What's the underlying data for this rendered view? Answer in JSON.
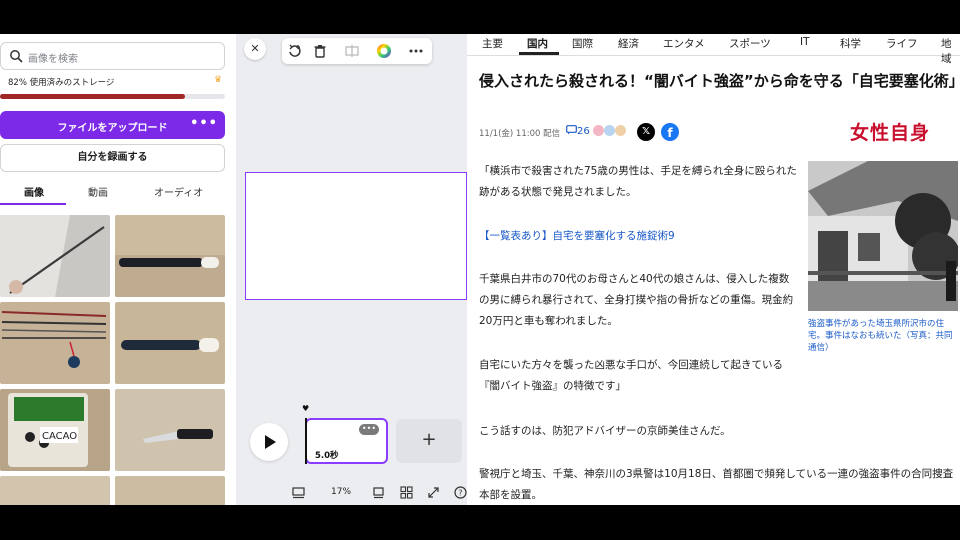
{
  "media_panel": {
    "search_placeholder": "画像を検索",
    "storage_text": "82% 使用済みのストレージ",
    "storage_used_fraction": 0.82,
    "upload_label": "ファイルをアップロード",
    "more_label": "•••",
    "record_label": "自分を録画する",
    "tabs": [
      "画像",
      "動画",
      "オーディオ"
    ],
    "active_tab": "画像"
  },
  "editor": {
    "close_label": "✕",
    "clip_duration": "5.0秒",
    "clip_menu": "•••",
    "add_clip": "+",
    "zoom": "17%"
  },
  "article": {
    "nav": [
      "主要",
      "国内",
      "国際",
      "経済",
      "エンタメ",
      "スポーツ",
      "IT",
      "科学",
      "ライフ",
      "地域"
    ],
    "active_nav": "国内",
    "headline": "侵入されたら殺される！“闇バイト強盗”から命を守る「自宅要塞化術」",
    "meta": "11/1(金) 11:00 配信",
    "comment_count": "26",
    "x_label": "𝕏",
    "fb_label": "f",
    "publisher": "女性自身",
    "paragraphs": [
      "「横浜市で殺害された75歳の男性は、手足を縛られ全身に殴られた跡がある状態で発見されました。",
      "【一覧表あり】自宅を要塞化する施錠術9",
      "千葉県白井市の70代のお母さんと40代の娘さんは、侵入した複数の男に縛られ暴行されて、全身打撲や指の骨折などの重傷。現金約20万円と車も奪われました。",
      "自宅にいた方々を襲った凶悪な手口が、今回連続して起きている『闇バイト強盗』の特徴です」",
      "こう話すのは、防犯アドバイザーの京師美佳さんだ。",
      "警視庁と埼玉、千葉、神奈川の3県警は10月18日、首都圏で頻発している一連の強盗事件の合同捜査本部を設置。"
    ],
    "photo_caption": "強盗事件があった埼玉県所沢市の住宅。事件はなおも続いた（写真：共同通信）"
  },
  "colors": {
    "accent_purple": "#7d2ae8",
    "storage_bar": "#a12727",
    "link_blue": "#1a5ac8",
    "publisher_red": "#c8102e"
  }
}
